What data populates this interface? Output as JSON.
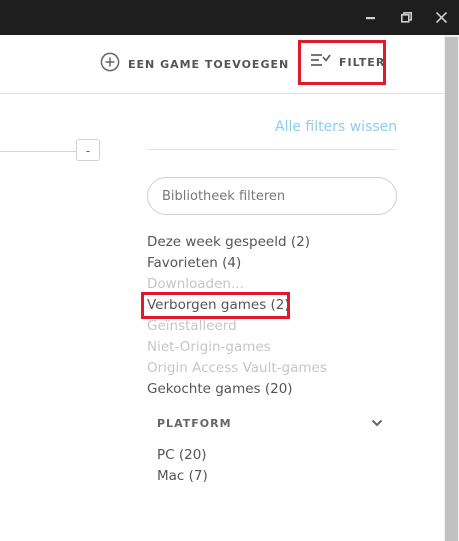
{
  "window": {
    "controls": [
      {
        "name": "minimize-icon"
      },
      {
        "name": "restore-icon"
      },
      {
        "name": "close-icon"
      }
    ]
  },
  "header": {
    "add_game_label": "EEN GAME TOEVOEGEN",
    "filter_label": "FILTER"
  },
  "filter_panel": {
    "clear_filters": "Alle filters wissen",
    "search_placeholder": "Bibliotheek filteren",
    "items": [
      {
        "label": "Deze week gespeeld (2)",
        "enabled": true
      },
      {
        "label": "Favorieten (4)",
        "enabled": true
      },
      {
        "label": "Downloaden...",
        "enabled": false
      },
      {
        "label": "Verborgen games (2)",
        "enabled": true,
        "highlighted": true
      },
      {
        "label": "Geïnstalleerd",
        "enabled": false
      },
      {
        "label": "Niet-Origin-games",
        "enabled": false
      },
      {
        "label": "Origin Access Vault-games",
        "enabled": false
      },
      {
        "label": "Gekochte games (20)",
        "enabled": true
      }
    ],
    "platform": {
      "title": "PLATFORM",
      "items": [
        {
          "label": "PC (20)"
        },
        {
          "label": "Mac (7)"
        }
      ]
    }
  },
  "left_panel": {
    "collapse_button": "-"
  },
  "colors": {
    "highlight": "#e01a2b",
    "link": "#8ecdf0",
    "titlebar": "#1e1e1e"
  }
}
